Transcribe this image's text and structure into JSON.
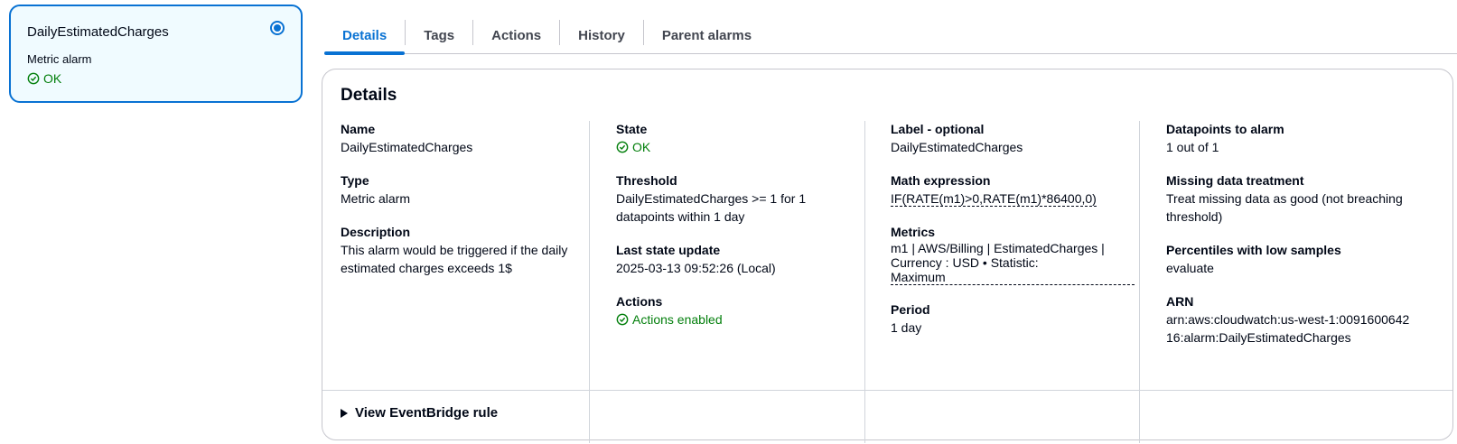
{
  "alarm_card": {
    "title": "DailyEstimatedCharges",
    "type": "Metric alarm",
    "status": "OK"
  },
  "tabs": [
    {
      "label": "Details"
    },
    {
      "label": "Tags"
    },
    {
      "label": "Actions"
    },
    {
      "label": "History"
    },
    {
      "label": "Parent alarms"
    }
  ],
  "details": {
    "header": "Details",
    "name_label": "Name",
    "name_value": "DailyEstimatedCharges",
    "type_label": "Type",
    "type_value": "Metric alarm",
    "description_label": "Description",
    "description_value": "This alarm would be triggered if the daily estimated charges exceeds 1$",
    "state_label": "State",
    "state_value": "OK",
    "threshold_label": "Threshold",
    "threshold_value": "DailyEstimatedCharges >= 1 for 1 datapoints within 1 day",
    "last_update_label": "Last state update",
    "last_update_value": "2025-03-13 09:52:26 (Local)",
    "actions_label": "Actions",
    "actions_value": "Actions enabled",
    "label_label": "Label - optional",
    "label_value": "DailyEstimatedCharges",
    "math_label": "Math expression",
    "math_value": "IF(RATE(m1)>0,RATE(m1)*86400,0)",
    "metrics_label": "Metrics",
    "metrics_line1": "m1 | AWS/Billing | EstimatedCharges |",
    "metrics_line2": "Currency : USD • Statistic: Maximum",
    "period_label": "Period",
    "period_value": "1 day",
    "datapoints_label": "Datapoints to alarm",
    "datapoints_value": "1 out of 1",
    "missing_label": "Missing data treatment",
    "missing_value": "Treat missing data as good (not breaching threshold)",
    "percentiles_label": "Percentiles with low samples",
    "percentiles_value": "evaluate",
    "arn_label": "ARN",
    "arn_value": "arn:aws:cloudwatch:us-west-1:009160064216:alarm:DailyEstimatedCharges"
  },
  "expander": {
    "label": "View EventBridge rule"
  },
  "colors": {
    "accent": "#0972d3",
    "ok": "#037f0c"
  }
}
